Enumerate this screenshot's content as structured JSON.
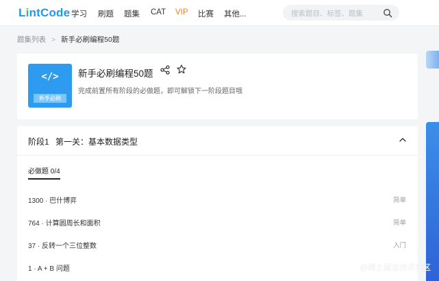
{
  "nav": {
    "logo_part1": "L",
    "logo_part2": "i",
    "logo_part3": "ntCode",
    "items": [
      "学习",
      "刷题",
      "题集",
      "CAT",
      "VIP",
      "比赛",
      "其他..."
    ],
    "search_placeholder": "搜索题目、标签、题集"
  },
  "breadcrumb": {
    "parent": "题集列表",
    "separator": ">",
    "current": "新手必刷编程50题"
  },
  "header": {
    "cover_code": "</>",
    "cover_tag": "新手必刷",
    "title": "新手必刷编程50题",
    "description": "完成前置所有阶段的必做题，即可解锁下一阶段题目哦"
  },
  "stage": {
    "number": "阶段1",
    "title": "第一关：基本数据类型",
    "required_tab": "必做题 0/4",
    "questions": [
      {
        "name": "1300 · 巴什博弈",
        "difficulty": "简单"
      },
      {
        "name": "764 · 计算圆周长和面积",
        "difficulty": "简单"
      },
      {
        "name": "37 · 反转一个三位整数",
        "difficulty": "入门"
      },
      {
        "name": "1 · A + B 问题",
        "difficulty": ""
      }
    ]
  },
  "watermark": "@稀土掘金技术社区",
  "colors": {
    "brand": "#1a9bf3",
    "vip": "#ff7a1a",
    "cover": "#2d9bf0"
  }
}
